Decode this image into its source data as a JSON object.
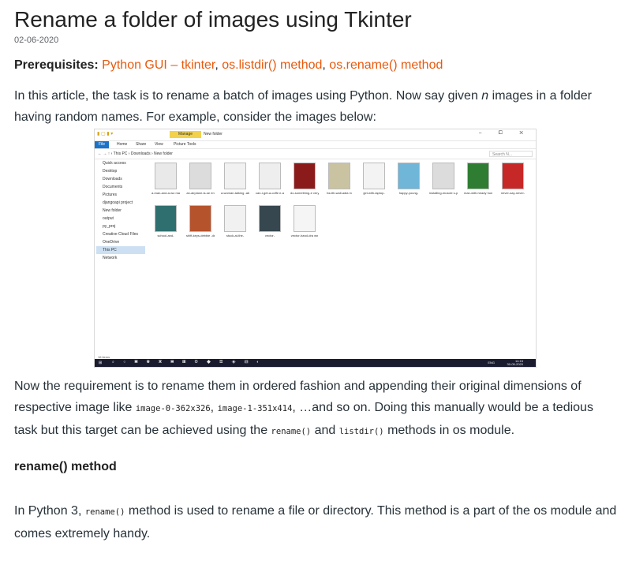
{
  "article": {
    "title": "Rename a folder of images using Tkinter",
    "date": "02-06-2020",
    "prereq_label": "Prerequisites:",
    "prereq_links": [
      "Python GUI – tkinter",
      "os.listdir() method",
      "os.rename() method"
    ],
    "prereq_sep": ", ",
    "p1_a": "In this article, the task is to rename a batch of images using Python. Now say given ",
    "p1_n": "n",
    "p1_b": " images in a folder having random names. For example, consider the images below:",
    "p2_a": "Now the requirement is to rename them in ordered fashion and appending their original dimensions of respective image like ",
    "p2_code1": "image-0-362x326",
    "p2_sep": ", ",
    "p2_code2": "image-1-351x414",
    "p2_b": ", …and so on. Doing this manually would be a tedious task but this target can be achieved using the ",
    "p2_code3": "rename()",
    "p2_and": " and ",
    "p2_code4": "listdir()",
    "p2_c": " methods in os module.",
    "h3": "rename() method",
    "p3_a": "In Python 3, ",
    "p3_code": "rename()",
    "p3_b": " method is used to rename a file or directory. This method is a part of the os module and comes extremely handy."
  },
  "screenshot": {
    "manage_tab": "Manage",
    "window_title": "New folder",
    "window_controls": "–  ⧠  ✕",
    "ribbon_tabs": [
      "File",
      "Home",
      "Share",
      "View",
      "Picture Tools"
    ],
    "address": "← → ↑  ›  This PC  ›  Downloads  ›  New folder",
    "search_placeholder": "Search N...",
    "nav_items": [
      "Quick access",
      "Desktop",
      "Downloads",
      "Documents",
      "Pictures",
      "djangoapi project",
      "New folder",
      "output",
      "py_proj",
      "Creative Cloud Files",
      "OneDrive",
      "This PC",
      "Network"
    ],
    "files": [
      "a-man-and-a-wo man",
      "an-airplane-is-se en",
      "a-woman-talking -about-her-",
      "can-i-get-a-coffe e-and-a-",
      "do-something-e very-day-tgrov",
      "fourth-wall-adia m",
      "girl-with-laptop-",
      "happy-young-",
      "installing-muscle s-please",
      "man-with-heady humor",
      "never-say-never-",
      "school-and-",
      "shift-keys-debbie -dewitt-",
      "stuck-at-the-",
      "vector-",
      "vector-hand-dra wn"
    ],
    "status": "16 items",
    "taskbar_lang": "ENG",
    "taskbar_time": "14:15",
    "taskbar_date": "30-05-2020"
  },
  "colors": {
    "link": "#e8590c",
    "text": "#273239",
    "file_tab": "#1a73c8",
    "manage_tab": "#f2d24c",
    "taskbar": "#1b1b2f"
  }
}
